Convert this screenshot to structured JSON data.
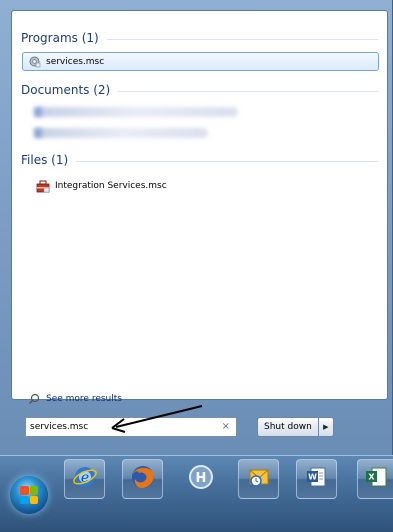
{
  "results": {
    "programs_header": "Programs (1)",
    "programs": [
      {
        "label": "services.msc",
        "icon": "gear-icon"
      }
    ],
    "documents_header": "Documents (2)",
    "files_header": "Files (1)",
    "files": [
      {
        "label": "Integration Services.msc",
        "icon": "toolbox-icon"
      }
    ],
    "see_more": "See more results"
  },
  "search": {
    "value": "services.msc",
    "clear_icon": "×"
  },
  "shutdown": {
    "label": "Shut down",
    "arrow": "▶"
  },
  "taskbar": {
    "items": [
      "start-orb",
      "internet-explorer-icon",
      "firefox-icon",
      "h-app-icon",
      "outlook-icon",
      "word-icon",
      "excel-icon"
    ]
  },
  "colors": {
    "accent": "#1e3a7a",
    "highlight_border": "#7da2ce",
    "taskbar": "#466f9b"
  }
}
